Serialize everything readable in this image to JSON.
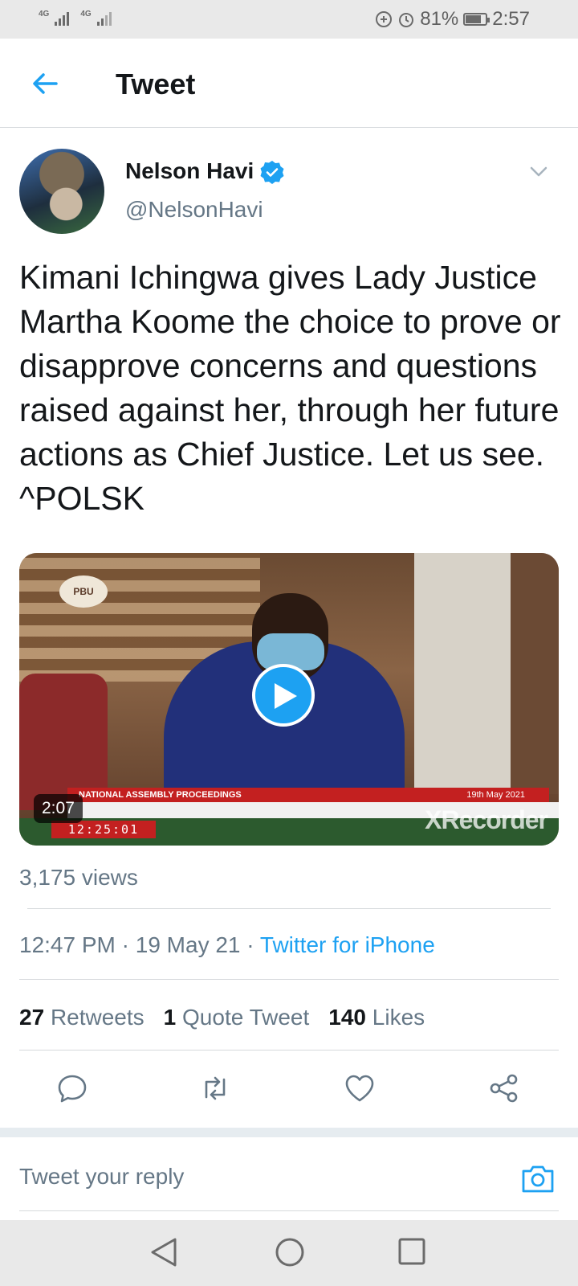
{
  "status_bar": {
    "signal1_label": "4G",
    "signal2_label": "4G",
    "battery_percent": "81%",
    "battery_level": 0.81,
    "time": "2:57"
  },
  "header": {
    "title": "Tweet"
  },
  "tweet": {
    "author_name": "Nelson Havi",
    "author_handle": "@NelsonHavi",
    "text": "Kimani Ichingwa gives Lady Justice Martha Koome the choice to prove or disapprove concerns and questions raised against her, through her future actions as Chief Justice. Let us see. ^POLSK",
    "video": {
      "duration": "2:07",
      "banner_text": "NATIONAL ASSEMBLY PROCEEDINGS",
      "banner_date": "19th May 2021",
      "clock": "12:25:01",
      "watermark": "XRecorder",
      "logo_text": "PBU"
    },
    "views": "3,175 views",
    "time": "12:47 PM",
    "date": "19 May 21",
    "separator": " · ",
    "source": "Twitter for iPhone",
    "stats": {
      "retweets_count": "27",
      "retweets_label": "Retweets",
      "quotes_count": "1",
      "quotes_label": "Quote Tweet",
      "likes_count": "140",
      "likes_label": "Likes"
    }
  },
  "reply": {
    "placeholder": "Tweet your reply"
  },
  "colors": {
    "accent": "#1da1f2",
    "text_primary": "#14171a",
    "text_secondary": "#657786"
  },
  "icons": [
    "back-arrow-icon",
    "verified-badge-icon",
    "chevron-down-icon",
    "play-icon",
    "reply-icon",
    "retweet-icon",
    "like-icon",
    "share-icon",
    "camera-icon",
    "nav-back-icon",
    "nav-home-icon",
    "nav-recent-icon"
  ]
}
